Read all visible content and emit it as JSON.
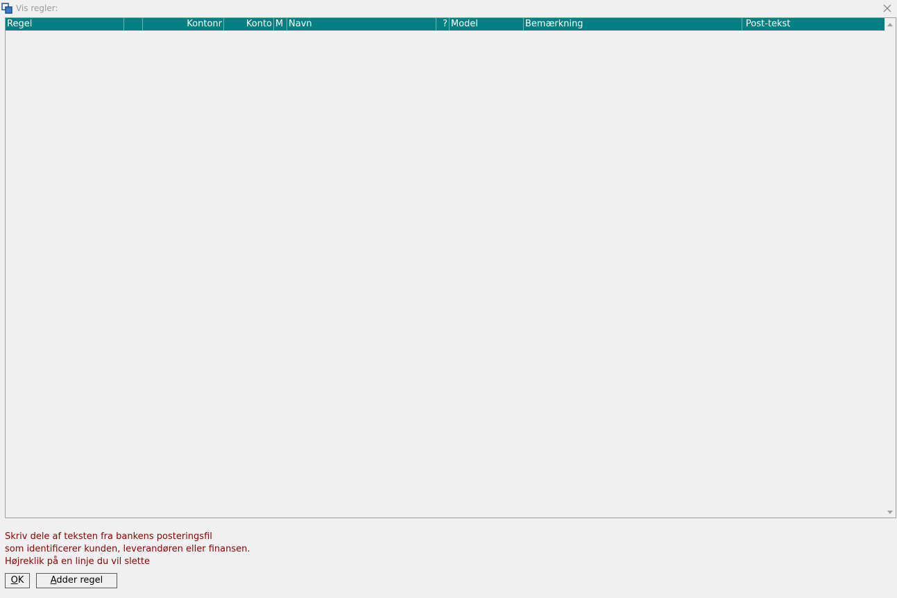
{
  "window": {
    "title": "Vis regler:",
    "icon": "window-app-icon",
    "close_icon": "close-icon"
  },
  "grid": {
    "columns": [
      {
        "label": "Regel"
      },
      {
        "label": ""
      },
      {
        "label": "Kontonr"
      },
      {
        "label": "Konto"
      },
      {
        "label": "M"
      },
      {
        "label": "Navn"
      },
      {
        "label": "?"
      },
      {
        "label": "Model"
      },
      {
        "label": "Bemærkning"
      },
      {
        "label": "Post-tekst"
      }
    ],
    "rows": [],
    "header_color": "#008080"
  },
  "info": {
    "line1": "Skriv dele af teksten fra bankens posteringsfil",
    "line2": "som identificerer kunden, leverandøren eller finansen.",
    "line3": "Højreklik på en linje du vil slette",
    "color": "#8b0000"
  },
  "buttons": {
    "ok": {
      "first": "O",
      "rest": "K"
    },
    "add": {
      "first": "A",
      "rest": "dder regel"
    }
  }
}
